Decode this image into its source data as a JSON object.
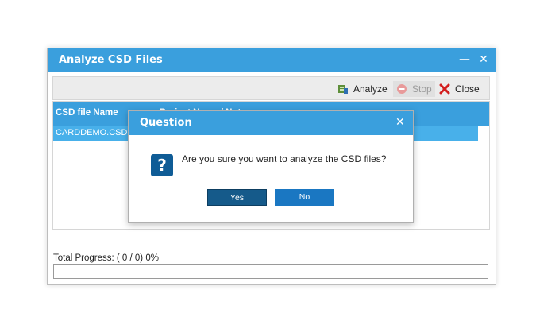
{
  "window": {
    "title": "Analyze CSD Files",
    "minimize_glyph": "—",
    "close_glyph": "✕"
  },
  "toolbar": {
    "analyze_label": "Analyze",
    "stop_label": "Stop",
    "close_label": "Close"
  },
  "grid": {
    "columns": [
      "CSD file Name",
      "Project Name / Notes"
    ],
    "rows": [
      {
        "file": "CARDDEMO.CSD"
      }
    ]
  },
  "progress": {
    "label": "Total Progress: ( 0 / 0) 0%",
    "value_percent": 0
  },
  "dialog": {
    "title": "Question",
    "close_glyph": "✕",
    "icon_glyph": "?",
    "message": "Are you sure you want to analyze the CSD files?",
    "yes_label": "Yes",
    "no_label": "No"
  },
  "colors": {
    "accent": "#3a9fdd",
    "selected_row": "#48b0ea",
    "question_icon": "#0f5c96"
  },
  "icons": {
    "analyze": "analyze-icon",
    "stop": "stop-icon",
    "close": "red-x-icon",
    "question": "question-icon"
  }
}
